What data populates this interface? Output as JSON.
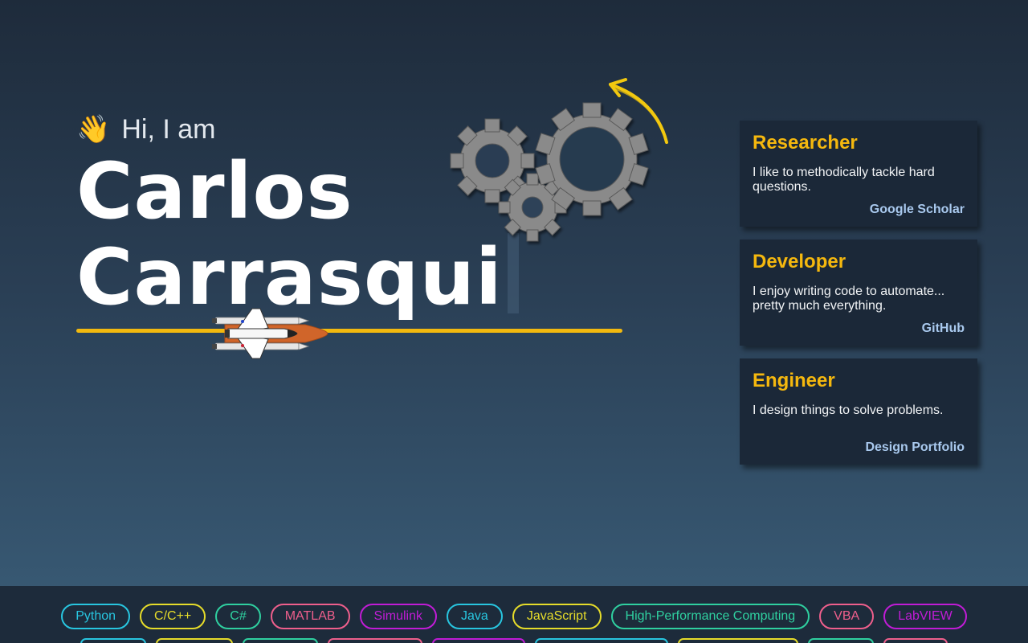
{
  "hero": {
    "wave_emoji": "👋",
    "greeting": "Hi, I am",
    "name_first": "Carlos",
    "name_last": "Carrasqui"
  },
  "colors": {
    "accent": "#f2b90f",
    "card_title": "#f5b80e",
    "card_link": "#a9c9ee",
    "card_bg": "#1b2838"
  },
  "icons": {
    "gears": "gears-icon",
    "arrow": "curved-arrow-icon",
    "shuttle": "space-shuttle-icon"
  },
  "cards": [
    {
      "title": "Researcher",
      "description": "I like to methodically tackle hard questions.",
      "link": "Google Scholar"
    },
    {
      "title": "Developer",
      "description": "I enjoy writing code to automate... pretty much everything.",
      "link": "GitHub"
    },
    {
      "title": "Engineer",
      "description": "I design things to solve problems.",
      "link": "Design Portfolio"
    }
  ],
  "skills": [
    "Python",
    "C/C++",
    "C#",
    "MATLAB",
    "Simulink",
    "Java",
    "JavaScript",
    "High-Performance Computing",
    "VBA",
    "LabVIEW"
  ]
}
